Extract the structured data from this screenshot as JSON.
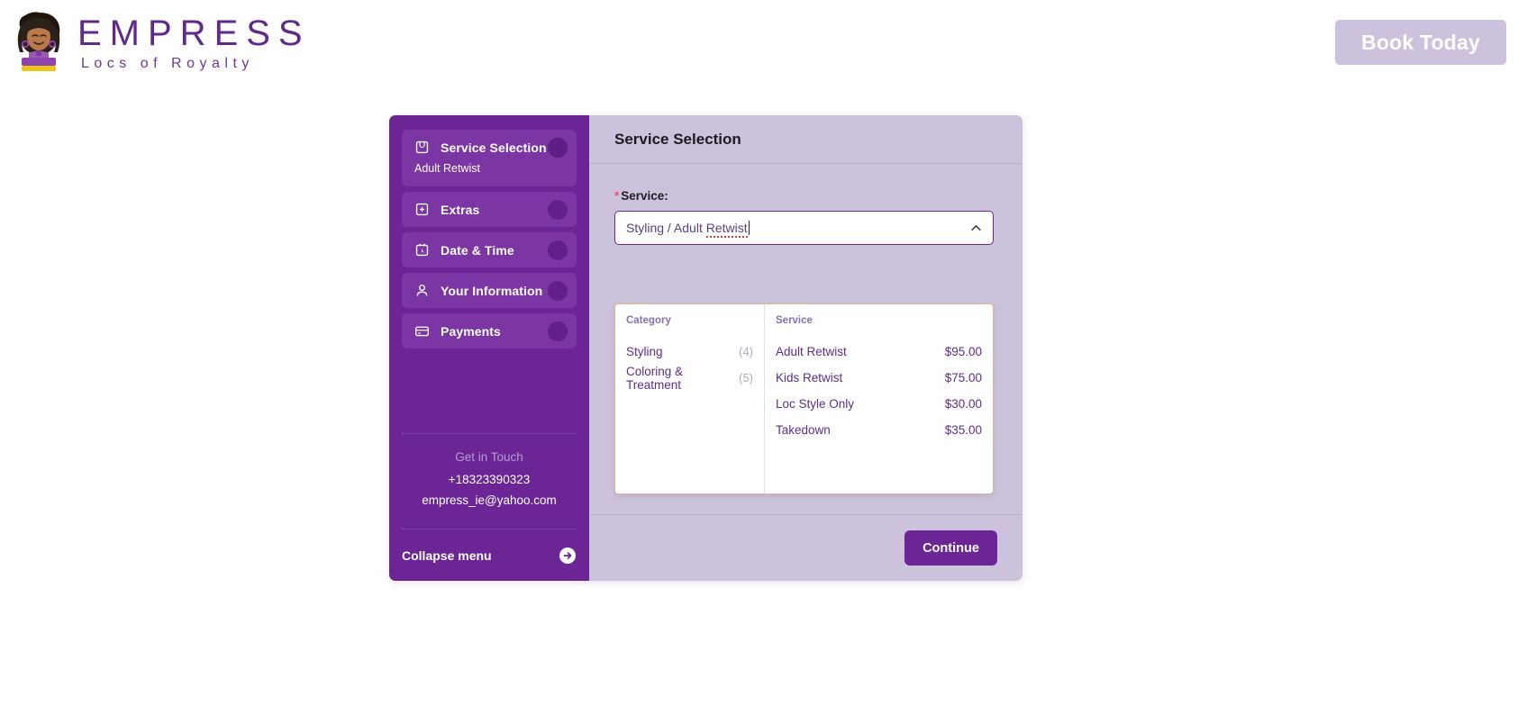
{
  "header": {
    "brand_name": "EMPRESS",
    "brand_tagline": "Locs of Royalty",
    "book_today_label": "Book Today"
  },
  "colors": {
    "brand_purple": "#6b2595",
    "panel_lavender": "#cdc2dc",
    "book_button": "#cdc2dd",
    "required_star": "#e8536b",
    "dropdown_border": "#d9b98e"
  },
  "sidebar": {
    "steps": [
      {
        "label": "Service Selection",
        "icon": "shopping-bag-icon",
        "sublabel": "Adult Retwist",
        "active": true
      },
      {
        "label": "Extras",
        "icon": "plus-box-icon",
        "sublabel": "",
        "active": false
      },
      {
        "label": "Date & Time",
        "icon": "calendar-clock-icon",
        "sublabel": "",
        "active": false
      },
      {
        "label": "Your Information",
        "icon": "person-icon",
        "sublabel": "",
        "active": false
      },
      {
        "label": "Payments",
        "icon": "credit-card-icon",
        "sublabel": "",
        "active": false
      }
    ],
    "contact": {
      "title": "Get in Touch",
      "phone": "+18323390323",
      "email": "empress_ie@yahoo.com"
    },
    "collapse_label": "Collapse menu"
  },
  "main": {
    "title": "Service Selection",
    "service_field": {
      "label": "Service:",
      "required_marker": "*",
      "value_prefix": "Styling / Adult ",
      "value_misspelled": "Retwist",
      "full_value": "Styling / Adult Retwist"
    },
    "dropdown": {
      "category_header": "Category",
      "service_header": "Service",
      "categories": [
        {
          "name": "Styling",
          "count": "(4)"
        },
        {
          "name": "Coloring & Treatment",
          "count": "(5)"
        }
      ],
      "services": [
        {
          "name": "Adult Retwist",
          "price": "$95.00"
        },
        {
          "name": "Kids Retwist",
          "price": "$75.00"
        },
        {
          "name": "Loc Style Only",
          "price": "$30.00"
        },
        {
          "name": "Takedown",
          "price": "$35.00"
        }
      ]
    },
    "continue_label": "Continue"
  }
}
